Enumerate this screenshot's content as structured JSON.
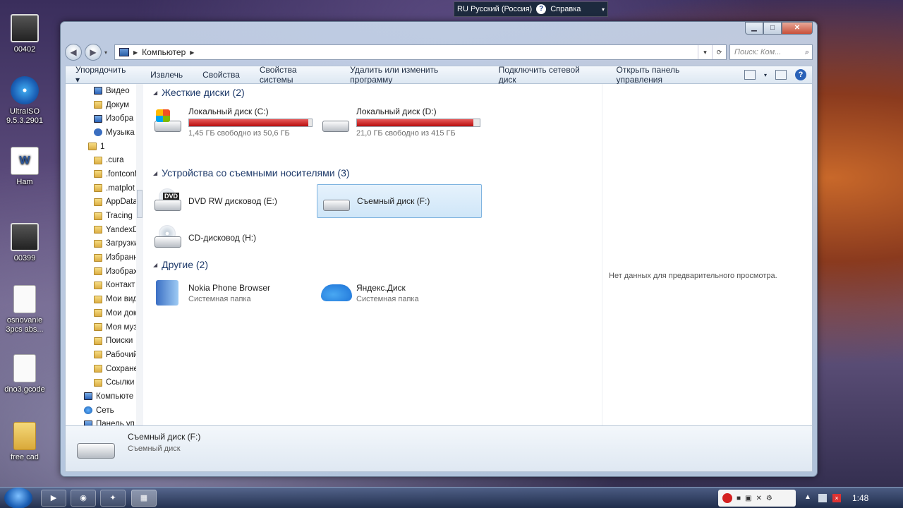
{
  "desktop": {
    "icons": [
      {
        "label": "00402"
      },
      {
        "label": "UltraISO 9.5.3.2901"
      },
      {
        "label": "Ham"
      },
      {
        "label": "00399"
      },
      {
        "label": "osnovanie 3pcs abs..."
      },
      {
        "label": "dno3.gcode"
      },
      {
        "label": "free cad"
      }
    ]
  },
  "langbar": {
    "language": "RU Русский (Россия)",
    "help": "Справка"
  },
  "window": {
    "breadcrumb": "Компьютер",
    "search_placeholder": "Поиск: Ком...",
    "toolbar": {
      "organize": "Упорядочить ▾",
      "eject": "Извлечь",
      "properties": "Свойства",
      "system_properties": "Свойства системы",
      "uninstall": "Удалить или изменить программу",
      "map_drive": "Подключить сетевой диск",
      "control_panel": "Открыть панель управления"
    },
    "nav": [
      {
        "label": "Видео",
        "icon": "video"
      },
      {
        "label": "Докум",
        "icon": "documents"
      },
      {
        "label": "Изобра",
        "icon": "pictures"
      },
      {
        "label": "Музыка",
        "icon": "music"
      },
      {
        "label": "1",
        "icon": "folder"
      },
      {
        "label": ".cura",
        "icon": "folder"
      },
      {
        "label": ".fontconf",
        "icon": "folder"
      },
      {
        "label": ".matplot",
        "icon": "folder"
      },
      {
        "label": "AppData",
        "icon": "folder"
      },
      {
        "label": "Tracing",
        "icon": "folder"
      },
      {
        "label": "YandexD",
        "icon": "folder"
      },
      {
        "label": "Загрузки",
        "icon": "folder"
      },
      {
        "label": "Избранн",
        "icon": "folder"
      },
      {
        "label": "Изобрах",
        "icon": "folder"
      },
      {
        "label": "Контакт",
        "icon": "folder"
      },
      {
        "label": "Мои вид",
        "icon": "folder"
      },
      {
        "label": "Мои док",
        "icon": "folder"
      },
      {
        "label": "Моя муз",
        "icon": "folder"
      },
      {
        "label": "Поиски",
        "icon": "folder"
      },
      {
        "label": "Рабочий",
        "icon": "folder"
      },
      {
        "label": "Сохране",
        "icon": "folder"
      },
      {
        "label": "Ссылки",
        "icon": "folder"
      },
      {
        "label": "Компьюте",
        "icon": "computer"
      },
      {
        "label": "Сеть",
        "icon": "network"
      },
      {
        "label": "Панель уп",
        "icon": "control-panel"
      }
    ],
    "groups": {
      "hdd": {
        "title": "Жесткие диски (2)",
        "items": [
          {
            "name": "Локальный диск (C:)",
            "free": "1,45 ГБ свободно из 50,6 ГБ",
            "used_fraction": 0.97
          },
          {
            "name": "Локальный диск (D:)",
            "free": "21,0 ГБ свободно из 415 ГБ",
            "used_fraction": 0.95
          }
        ]
      },
      "removable": {
        "title": "Устройства со съемными носителями (3)",
        "items": [
          {
            "name": "DVD RW дисковод (E:)"
          },
          {
            "name": "Съемный диск (F:)"
          },
          {
            "name": "CD-дисковод (H:)"
          }
        ]
      },
      "other": {
        "title": "Другие (2)",
        "items": [
          {
            "name": "Nokia Phone Browser",
            "type": "Системная папка"
          },
          {
            "name": "Яндекс.Диск",
            "type": "Системная папка"
          }
        ]
      }
    },
    "preview": "Нет данных для предварительного просмотра.",
    "details": {
      "name": "Съемный диск (F:)",
      "type": "Съемный диск"
    }
  },
  "taskbar": {
    "clock": "1:48"
  },
  "colors": {
    "bar_fill": "#c41a1a",
    "selection": "#cfe6f8"
  }
}
